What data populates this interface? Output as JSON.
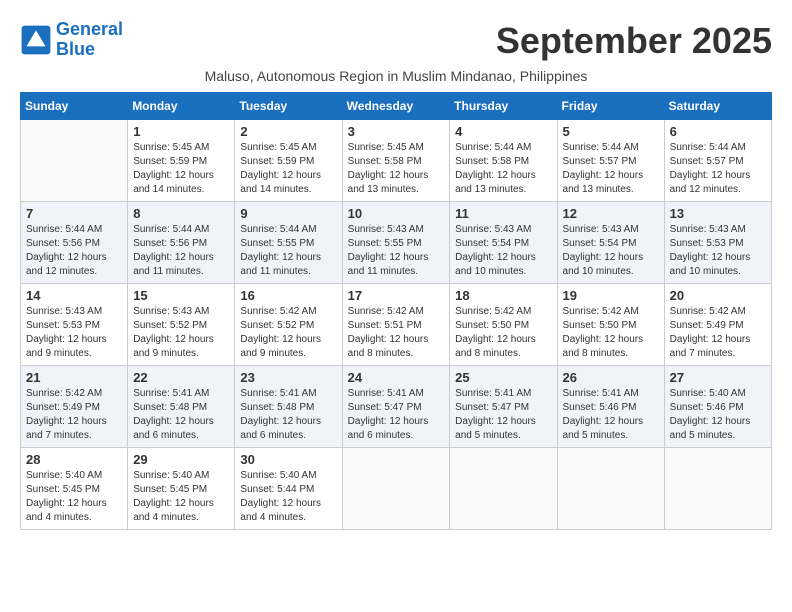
{
  "header": {
    "logo_line1": "General",
    "logo_line2": "Blue",
    "month_title": "September 2025",
    "subtitle": "Maluso, Autonomous Region in Muslim Mindanao, Philippines"
  },
  "weekdays": [
    "Sunday",
    "Monday",
    "Tuesday",
    "Wednesday",
    "Thursday",
    "Friday",
    "Saturday"
  ],
  "weeks": [
    [
      {
        "day": "",
        "info": ""
      },
      {
        "day": "1",
        "info": "Sunrise: 5:45 AM\nSunset: 5:59 PM\nDaylight: 12 hours\nand 14 minutes."
      },
      {
        "day": "2",
        "info": "Sunrise: 5:45 AM\nSunset: 5:59 PM\nDaylight: 12 hours\nand 14 minutes."
      },
      {
        "day": "3",
        "info": "Sunrise: 5:45 AM\nSunset: 5:58 PM\nDaylight: 12 hours\nand 13 minutes."
      },
      {
        "day": "4",
        "info": "Sunrise: 5:44 AM\nSunset: 5:58 PM\nDaylight: 12 hours\nand 13 minutes."
      },
      {
        "day": "5",
        "info": "Sunrise: 5:44 AM\nSunset: 5:57 PM\nDaylight: 12 hours\nand 13 minutes."
      },
      {
        "day": "6",
        "info": "Sunrise: 5:44 AM\nSunset: 5:57 PM\nDaylight: 12 hours\nand 12 minutes."
      }
    ],
    [
      {
        "day": "7",
        "info": "Sunrise: 5:44 AM\nSunset: 5:56 PM\nDaylight: 12 hours\nand 12 minutes."
      },
      {
        "day": "8",
        "info": "Sunrise: 5:44 AM\nSunset: 5:56 PM\nDaylight: 12 hours\nand 11 minutes."
      },
      {
        "day": "9",
        "info": "Sunrise: 5:44 AM\nSunset: 5:55 PM\nDaylight: 12 hours\nand 11 minutes."
      },
      {
        "day": "10",
        "info": "Sunrise: 5:43 AM\nSunset: 5:55 PM\nDaylight: 12 hours\nand 11 minutes."
      },
      {
        "day": "11",
        "info": "Sunrise: 5:43 AM\nSunset: 5:54 PM\nDaylight: 12 hours\nand 10 minutes."
      },
      {
        "day": "12",
        "info": "Sunrise: 5:43 AM\nSunset: 5:54 PM\nDaylight: 12 hours\nand 10 minutes."
      },
      {
        "day": "13",
        "info": "Sunrise: 5:43 AM\nSunset: 5:53 PM\nDaylight: 12 hours\nand 10 minutes."
      }
    ],
    [
      {
        "day": "14",
        "info": "Sunrise: 5:43 AM\nSunset: 5:53 PM\nDaylight: 12 hours\nand 9 minutes."
      },
      {
        "day": "15",
        "info": "Sunrise: 5:43 AM\nSunset: 5:52 PM\nDaylight: 12 hours\nand 9 minutes."
      },
      {
        "day": "16",
        "info": "Sunrise: 5:42 AM\nSunset: 5:52 PM\nDaylight: 12 hours\nand 9 minutes."
      },
      {
        "day": "17",
        "info": "Sunrise: 5:42 AM\nSunset: 5:51 PM\nDaylight: 12 hours\nand 8 minutes."
      },
      {
        "day": "18",
        "info": "Sunrise: 5:42 AM\nSunset: 5:50 PM\nDaylight: 12 hours\nand 8 minutes."
      },
      {
        "day": "19",
        "info": "Sunrise: 5:42 AM\nSunset: 5:50 PM\nDaylight: 12 hours\nand 8 minutes."
      },
      {
        "day": "20",
        "info": "Sunrise: 5:42 AM\nSunset: 5:49 PM\nDaylight: 12 hours\nand 7 minutes."
      }
    ],
    [
      {
        "day": "21",
        "info": "Sunrise: 5:42 AM\nSunset: 5:49 PM\nDaylight: 12 hours\nand 7 minutes."
      },
      {
        "day": "22",
        "info": "Sunrise: 5:41 AM\nSunset: 5:48 PM\nDaylight: 12 hours\nand 6 minutes."
      },
      {
        "day": "23",
        "info": "Sunrise: 5:41 AM\nSunset: 5:48 PM\nDaylight: 12 hours\nand 6 minutes."
      },
      {
        "day": "24",
        "info": "Sunrise: 5:41 AM\nSunset: 5:47 PM\nDaylight: 12 hours\nand 6 minutes."
      },
      {
        "day": "25",
        "info": "Sunrise: 5:41 AM\nSunset: 5:47 PM\nDaylight: 12 hours\nand 5 minutes."
      },
      {
        "day": "26",
        "info": "Sunrise: 5:41 AM\nSunset: 5:46 PM\nDaylight: 12 hours\nand 5 minutes."
      },
      {
        "day": "27",
        "info": "Sunrise: 5:40 AM\nSunset: 5:46 PM\nDaylight: 12 hours\nand 5 minutes."
      }
    ],
    [
      {
        "day": "28",
        "info": "Sunrise: 5:40 AM\nSunset: 5:45 PM\nDaylight: 12 hours\nand 4 minutes."
      },
      {
        "day": "29",
        "info": "Sunrise: 5:40 AM\nSunset: 5:45 PM\nDaylight: 12 hours\nand 4 minutes."
      },
      {
        "day": "30",
        "info": "Sunrise: 5:40 AM\nSunset: 5:44 PM\nDaylight: 12 hours\nand 4 minutes."
      },
      {
        "day": "",
        "info": ""
      },
      {
        "day": "",
        "info": ""
      },
      {
        "day": "",
        "info": ""
      },
      {
        "day": "",
        "info": ""
      }
    ]
  ]
}
